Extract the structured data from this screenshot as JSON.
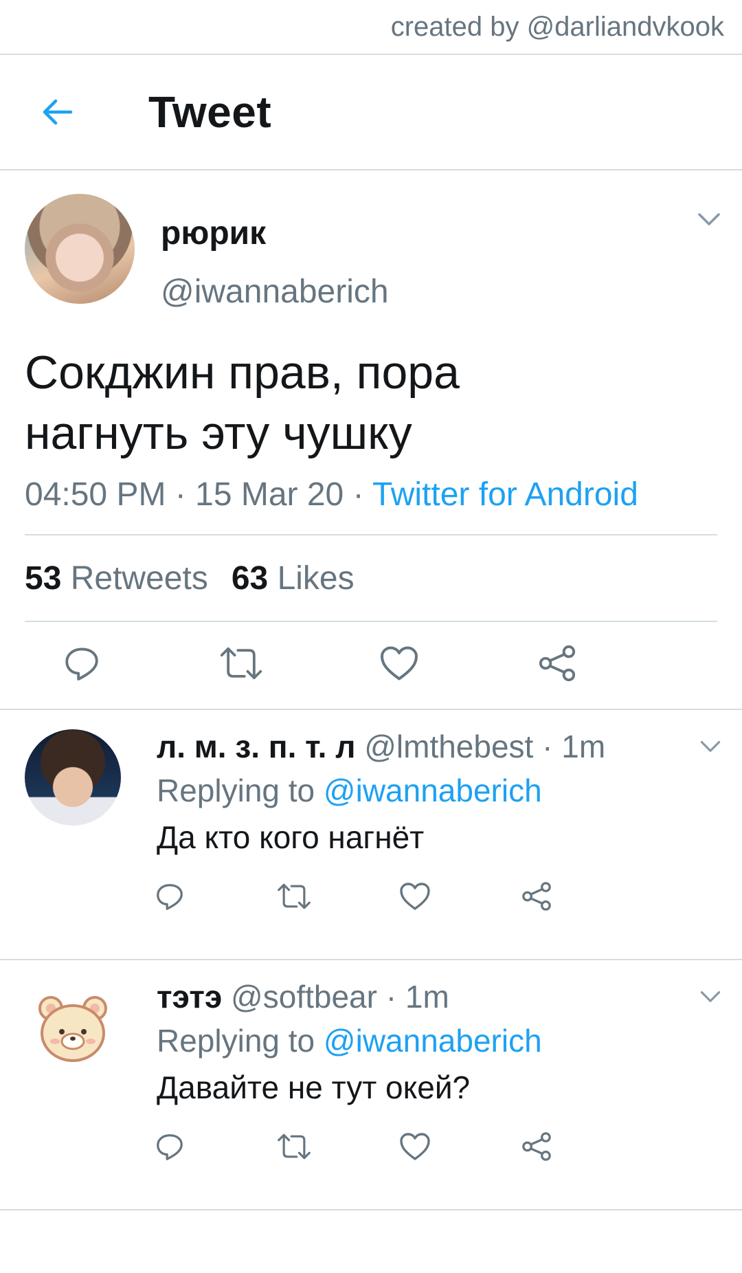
{
  "credit": "created by @darliandvkook",
  "header": {
    "title": "Tweet",
    "back_icon": "arrow-left-icon",
    "accent": "#1da1f2"
  },
  "tweet": {
    "display_name": "рюрик",
    "handle": "@iwannaberich",
    "text_line1": "Сокджин прав, пора",
    "text_line2": "нагнуть эту чушку",
    "time": "04:50 PM",
    "date": "15 Mar 20",
    "source": "Twitter for Android",
    "retweets_count": "53",
    "retweets_label": "Retweets",
    "likes_count": "63",
    "likes_label": "Likes"
  },
  "replies": [
    {
      "display_name": "л. м. з. п. т. л",
      "handle": "@lmthebest",
      "time": "1m",
      "replying_prefix": "Replying to",
      "replying_to": "@iwannaberich",
      "text": "Да кто кого нагнёт"
    },
    {
      "display_name": "тэтэ",
      "handle": "@softbear",
      "time": "1m",
      "replying_prefix": "Replying to",
      "replying_to": "@iwannaberich",
      "text": "Давайте не тут окей?"
    }
  ],
  "separator": "·",
  "colors": {
    "secondary_text": "#66757f",
    "link": "#1da1f2",
    "divider": "#d5dde3"
  }
}
